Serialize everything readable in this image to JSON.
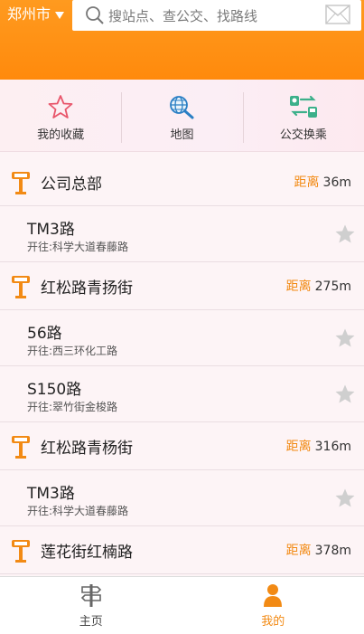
{
  "header": {
    "city": "郑州市",
    "search_placeholder": "搜站点、查公交、找路线"
  },
  "quick_nav": [
    {
      "label": "我的收藏",
      "icon": "star-outline-icon"
    },
    {
      "label": "地图",
      "icon": "globe-search-icon"
    },
    {
      "label": "公交换乘",
      "icon": "bus-transfer-icon"
    }
  ],
  "list": {
    "distance_label": "距离",
    "stops": [
      {
        "name": "公司总部",
        "distance": "36m",
        "routes": [
          {
            "route": "TM3路",
            "direction": "开往:科学大道春藤路"
          }
        ]
      },
      {
        "name": "红松路青扬街",
        "distance": "275m",
        "routes": [
          {
            "route": "56路",
            "direction": "开往:西三环化工路"
          },
          {
            "route": "S150路",
            "direction": "开往:翠竹街金梭路"
          }
        ]
      },
      {
        "name": "红松路青杨街",
        "distance": "316m",
        "routes": [
          {
            "route": "TM3路",
            "direction": "开往:科学大道春藤路"
          }
        ]
      },
      {
        "name": "莲花街红楠路",
        "distance": "378m",
        "routes": []
      }
    ]
  },
  "tabbar": {
    "home_label": "主页",
    "mine_label": "我的"
  },
  "colors": {
    "accent": "#ff8a0c",
    "distance_label": "#f28a14",
    "star_inactive": "#cfcfcf"
  }
}
